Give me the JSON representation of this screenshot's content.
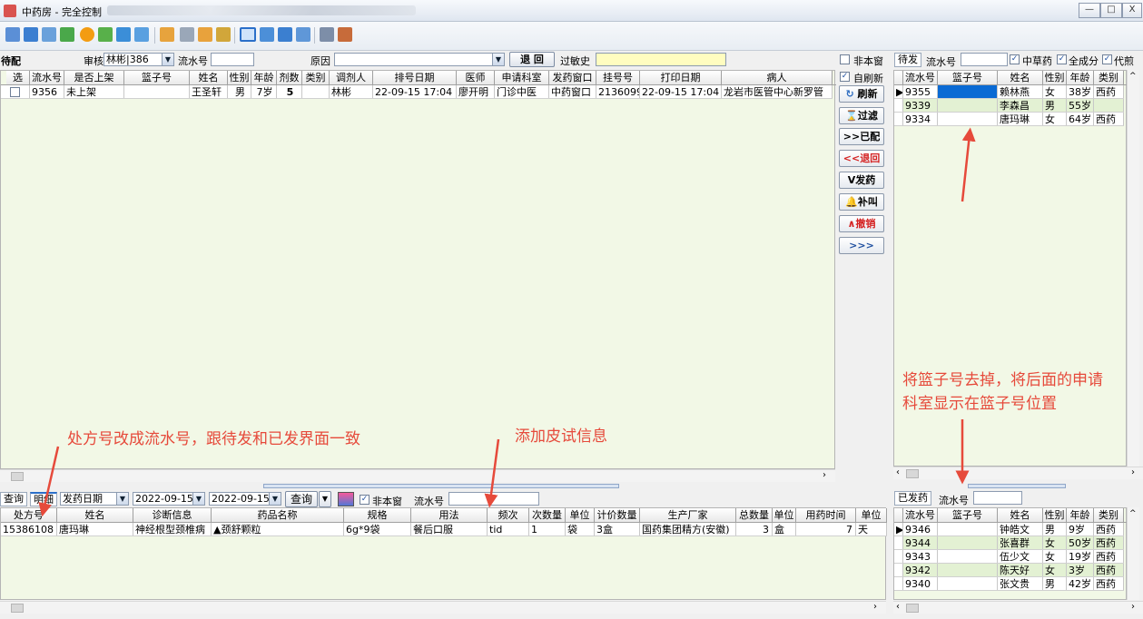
{
  "window": {
    "title": "中药房 - 完全控制",
    "controls": [
      "—",
      "□",
      "X"
    ]
  },
  "top_filter": {
    "mode_label": "待配",
    "reviewer_label": "审核",
    "reviewer_value": "林彬|386",
    "serial_label": "流水号",
    "serial_value": "",
    "reason_label": "原因",
    "reason_value": "",
    "return_button": "退 回",
    "allergy_label": "过敏史",
    "allergy_value": "",
    "non_window_label": "非本窗",
    "auto_refresh_label": "自刷新"
  },
  "main_table": {
    "headers": [
      "选",
      "流水号",
      "是否上架",
      "篮子号",
      "姓名",
      "性别",
      "年龄",
      "剂数",
      "类别",
      "调剂人",
      "排号日期",
      "医师",
      "申请科室",
      "发药窗口",
      "挂号号",
      "打印日期",
      "病人"
    ],
    "rows": [
      [
        "",
        "9356",
        "未上架",
        "",
        "王圣轩",
        "男",
        "7岁",
        "5",
        "",
        "林彬",
        "22-09-15 17:04",
        "廖开明",
        "门诊中医",
        "中药窗口",
        "2136099",
        "22-09-15 17:04",
        "龙岩市医管中心新罗管"
      ]
    ]
  },
  "side_buttons": {
    "refresh": "刷新",
    "filter": "过滤",
    "dispensed": ">>已配",
    "return": "<<退回",
    "dispense": "V发药",
    "recall": "补叫",
    "cancel": "∧撤销",
    "more": ">>>"
  },
  "pending_panel": {
    "tab_label": "待发",
    "serial_label": "流水号",
    "serial_value": "",
    "chinese_herb_label": "中草药",
    "granule_label": "全成分",
    "decoct_label": "代煎",
    "headers": [
      "流水号",
      "篮子号",
      "姓名",
      "性别",
      "年龄",
      "类别"
    ],
    "rows": [
      [
        "9355",
        "",
        "赖林燕",
        "女",
        "38岁",
        "西药"
      ],
      [
        "9339",
        "",
        "李森昌",
        "男",
        "55岁",
        ""
      ],
      [
        "9334",
        "",
        "唐玛琳",
        "女",
        "64岁",
        "西药"
      ]
    ]
  },
  "dispensed_panel": {
    "tab_label": "已发药",
    "serial_label": "流水号",
    "serial_value": "",
    "headers": [
      "流水号",
      "篮子号",
      "姓名",
      "性别",
      "年龄",
      "类别"
    ],
    "rows": [
      [
        "9346",
        "",
        "钟皓文",
        "男",
        "9岁",
        "西药"
      ],
      [
        "9344",
        "",
        "张喜群",
        "女",
        "50岁",
        "西药"
      ],
      [
        "9343",
        "",
        "伍少文",
        "女",
        "19岁",
        "西药"
      ],
      [
        "9342",
        "",
        "陈天好",
        "女",
        "3岁",
        "西药"
      ],
      [
        "9340",
        "",
        "张文贵",
        "男",
        "42岁",
        "西药"
      ]
    ]
  },
  "detail_filter": {
    "tab_query": "查询",
    "tab_detail": "明细",
    "date_type": "发药日期",
    "date_from": "2022-09-15",
    "date_to": "2022-09-15",
    "query_button": "查询",
    "non_window_label": "非本窗",
    "serial_label": "流水号",
    "serial_value": ""
  },
  "detail_table": {
    "headers": [
      "处方号",
      "姓名",
      "诊断信息",
      "药品名称",
      "规格",
      "用法",
      "频次",
      "次数量",
      "单位",
      "计价数量",
      "生产厂家",
      "总数量",
      "单位",
      "用药时间",
      "单位"
    ],
    "rows": [
      [
        "15386108",
        "唐玛琳",
        "神经根型颈椎病",
        "▲颈舒颗粒",
        "6g*9袋",
        "餐后口服",
        "tid",
        "1",
        "袋",
        "3盒",
        "国药集团精方(安徽)",
        "3",
        "盒",
        "7",
        "天"
      ]
    ]
  },
  "annotations": {
    "rx_to_serial": "处方号改成流水号，跟待发和已发界面一致",
    "skin_test": "添加皮试信息",
    "basket_line1": "将篮子号去掉，将后面的申请",
    "basket_line2": "科室显示在篮子号位置"
  },
  "colors": {
    "grid_background": "#f2f8e6",
    "alt_row": "#e3f1d3",
    "selected_cell": "#0a6ad4",
    "annotation": "#e64a3b",
    "allergy_field": "#fffdc0"
  }
}
